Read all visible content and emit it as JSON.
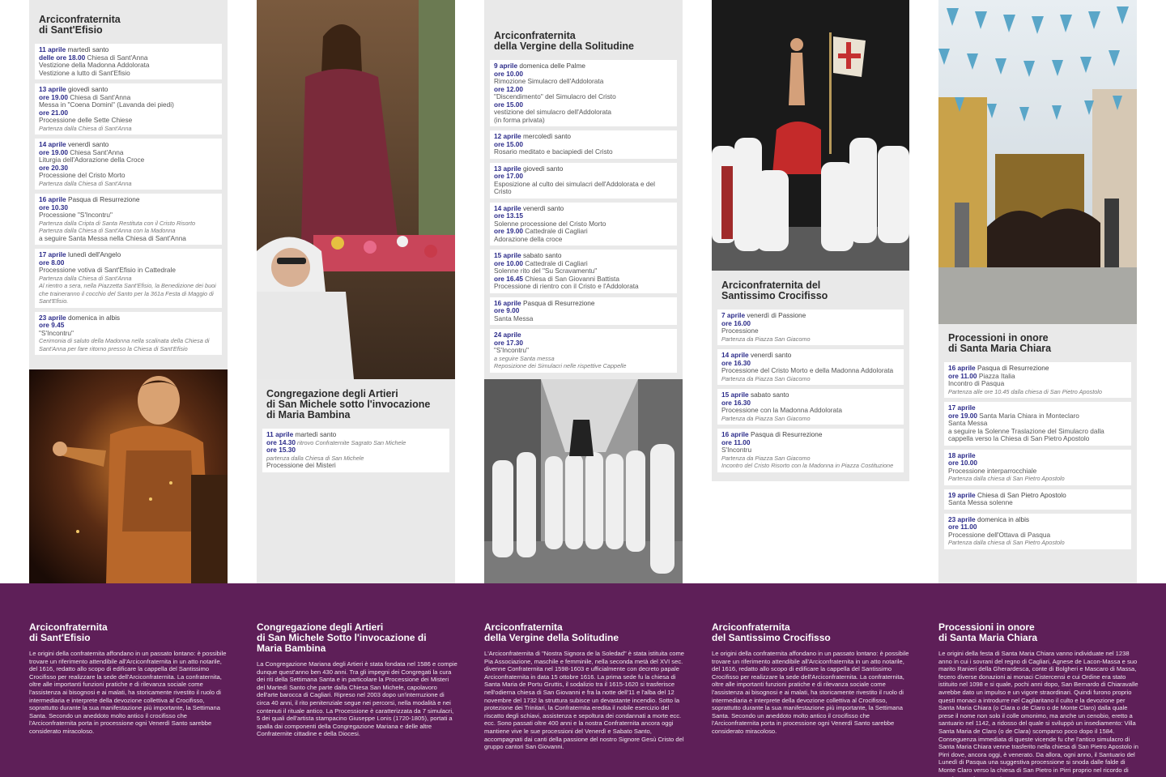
{
  "columns": [
    {
      "title": "Arciconfraternita\ndi Sant'Efisio",
      "events": [
        {
          "date": "11 aprile",
          "day": " martedì santo",
          "lines": [
            {
              "t": "delle ore 18.00",
              "x": " Chiesa di Sant'Anna"
            },
            {
              "x": "Vestizione della Madonna Addolorata"
            },
            {
              "x": "Vestizione a lutto di Sant'Efisio"
            }
          ]
        },
        {
          "date": "13 aprile",
          "day": " giovedì santo",
          "lines": [
            {
              "t": "ore 19.00",
              "x": " Chiesa di Sant'Anna"
            },
            {
              "x": "Messa in \"Coena Domini\" (Lavanda dei piedi)"
            },
            {
              "t": "ore 21.00"
            },
            {
              "x": "Processione delle Sette Chiese"
            },
            {
              "s": "Partenza dalla Chiesa di Sant'Anna"
            }
          ]
        },
        {
          "date": "14 aprile",
          "day": " venerdì santo",
          "lines": [
            {
              "t": "ore 19.00",
              "x": "        Chiesa Sant'Anna"
            },
            {
              "x": "Liturgia dell'Adorazione della Croce"
            },
            {
              "t": "ore 20.30"
            },
            {
              "x": "Processione del Cristo Morto"
            },
            {
              "s": "Partenza dalla Chiesa di Sant'Anna"
            }
          ]
        },
        {
          "date": "16 aprile",
          "day": " Pasqua di Resurrezione",
          "lines": [
            {
              "t": "ore 10.30"
            },
            {
              "x": "Processione \"S'Incontru\""
            },
            {
              "s": "Partenza dalla Cripta di Santa Restituta con il Cristo Risorto"
            },
            {
              "s": "Partenza dalla Chiesa di Sant'Anna con la Madonna"
            },
            {
              "x": "a seguire Santa Messa nella Chiesa di Sant'Anna"
            }
          ]
        },
        {
          "date": "17 aprile",
          "day": " lunedì dell'Angelo",
          "lines": [
            {
              "t": "ore 8.00"
            },
            {
              "x": "Processione votiva di Sant'Efisio in Cattedrale"
            },
            {
              "s": "Partenza dalla Chiesa di Sant'Anna"
            },
            {
              "s": "Al rientro a sera, nella Piazzetta Sant'Efisio, la Benedizione dei buoi che traineranno il cocchio del Santo per la 361a Festa di Maggio di Sant'Efisio."
            }
          ]
        },
        {
          "date": "23 aprile",
          "day": " domenica in albis",
          "lines": [
            {
              "t": "ore 9.45"
            },
            {
              "x": "\"S'Incontru\""
            },
            {
              "s": "Cerimonia di saluto della Madonna nella scalinata della Chiesa di Sant'Anna per fare ritorno presso la Chiesa di Sant'Efisio"
            }
          ]
        }
      ]
    },
    {
      "title": "Congregazione degli Artieri\ndi San Michele sotto l'invocazione\ndi Maria Bambina",
      "events": [
        {
          "date": "11 aprile",
          "day": " martedì santo",
          "lines": [
            {
              "t": "ore 14.30",
              "s": " ritrovo Confraternite Sagrato San Michele"
            },
            {
              "t": "ore 15.30"
            },
            {
              "s": "partenza dalla Chiesa di San Michele"
            },
            {
              "x": "Processione dei Misteri"
            }
          ]
        }
      ]
    },
    {
      "title": "Arciconfraternita\ndella Vergine della Solitudine",
      "events": [
        {
          "date": "9 aprile",
          "day": " domenica delle Palme",
          "lines": [
            {
              "t": "ore 10.00"
            },
            {
              "x": "Rimozione Simulacro dell'Addolorata"
            },
            {
              "t": "ore 12.00"
            },
            {
              "x": "\"Discendimento\" del Simulacro del Cristo"
            },
            {
              "t": "ore 15.00"
            },
            {
              "x": "vestizione del simulacro dell'Addolorata"
            },
            {
              "x": "(in forma privata)"
            }
          ]
        },
        {
          "date": "12 aprile",
          "day": " mercoledì santo",
          "lines": [
            {
              "t": "ore 15.00"
            },
            {
              "x": "Rosario meditato e baciapiedi del Cristo"
            }
          ]
        },
        {
          "date": "13 aprile",
          "day": " giovedì santo",
          "lines": [
            {
              "t": "ore 17.00"
            },
            {
              "x": "Esposizione al culto dei simulacri dell'Addolorata e del Cristo"
            }
          ]
        },
        {
          "date": "14 aprile",
          "day": " venerdì santo",
          "lines": [
            {
              "t": "ore 13.15"
            },
            {
              "x": "Solenne processione del Cristo Morto"
            },
            {
              "t": "ore 19.00",
              "x": " Cattedrale di Cagliari"
            },
            {
              "x": "Adorazione della croce"
            }
          ]
        },
        {
          "date": "15 aprile",
          "day": " sabato santo",
          "lines": [
            {
              "t": "ore 10.00",
              "x": "  Cattedrale di Cagliari"
            },
            {
              "x": "Solenne rito del \"Su Scravamentu\""
            },
            {
              "t": "ore 16.45",
              "x": " Chiesa di San Giovanni Battista"
            },
            {
              "x": "Processione di rientro con il Cristo e l'Addolorata"
            }
          ]
        },
        {
          "date": "16 aprile",
          "day": " Pasqua di Resurrezione",
          "lines": [
            {
              "t": "ore 9.00"
            },
            {
              "x": "Santa Messa"
            }
          ]
        },
        {
          "date": "24 aprile",
          "day": "",
          "lines": [
            {
              "t": "ore 17.30"
            },
            {
              "x": "\"S'Incontru\""
            },
            {
              "s": "a seguire Santa messa"
            },
            {
              "s": "Reposizione dei Simulacri nelle rispettive Cappelle"
            }
          ]
        }
      ]
    },
    {
      "title": "Arciconfraternita del\nSantissimo Crocifisso",
      "events": [
        {
          "date": "7 aprile",
          "day": " venerdì di Passione",
          "lines": [
            {
              "t": "ore 16.00"
            },
            {
              "x": "Processione"
            },
            {
              "s": "Partenza da Piazza San Giacomo"
            }
          ]
        },
        {
          "date": "14 aprile",
          "day": " venerdì santo",
          "lines": [
            {
              "t": "ore 16.30"
            },
            {
              "x": "Processione del Cristo Morto e della Madonna Addolorata"
            },
            {
              "s": "Partenza da Piazza San Giacomo"
            }
          ]
        },
        {
          "date": "15 aprile",
          "day": " sabato santo",
          "lines": [
            {
              "t": "ore 16.30"
            },
            {
              "x": "Processione con la Madonna Addolorata"
            },
            {
              "s": "Partenza da Piazza San Giacomo"
            }
          ]
        },
        {
          "date": "16 aprile",
          "day": " Pasqua di Resurrezione",
          "lines": [
            {
              "t": "ore 11.00"
            },
            {
              "x": "S'Incontru"
            },
            {
              "s": "Partenza da Piazza San Giacomo"
            },
            {
              "s": "Incontro del Cristo Risorto con la Madonna in Piazza Costituzione"
            }
          ]
        }
      ]
    },
    {
      "title": "Processioni in onore\ndi Santa Maria Chiara",
      "events": [
        {
          "date": "16 aprile",
          "day": "        Pasqua di Resurrezione",
          "lines": [
            {
              "t": "ore 11.00",
              "x": "        Piazza Italia"
            },
            {
              "x": "Incontro di Pasqua"
            },
            {
              "s": "Partenza alle ore 10.45 dalla chiesa di San Pietro Apostolo"
            }
          ]
        },
        {
          "date": "17 aprile",
          "day": "",
          "lines": [
            {
              "t": "ore 19.00",
              "x": " Santa Maria Chiara in Monteclaro"
            },
            {
              "x": "Santa Messa"
            },
            {
              "x": "a seguire la Solenne Traslazione del Simulacro dalla cappella verso la Chiesa di San Pietro Apostolo"
            }
          ]
        },
        {
          "date": "18 aprile",
          "day": "",
          "lines": [
            {
              "t": "ore 10.00"
            },
            {
              "x": "Processione interparrocchiale"
            },
            {
              "s": "Partenza dalla chiesa di San Pietro Apostolo"
            }
          ]
        },
        {
          "date": "19 aprile",
          "day": " Chiesa di San Pietro Apostolo",
          "lines": [
            {
              "x": "Santa Messa solenne"
            }
          ]
        },
        {
          "date": "23 aprile",
          "day": " domenica in albis",
          "lines": [
            {
              "t": "ore 11.00"
            },
            {
              "x": "Processione dell'Ottava di Pasqua"
            },
            {
              "s": "Partenza dalla chiesa di San Pietro Apostolo"
            }
          ]
        }
      ]
    }
  ],
  "bottom": [
    {
      "title": "Arciconfraternita\ndi Sant'Efisio",
      "text": "Le origini della confraternita affondano in un passato lontano: è possibile trovare un riferimento attendibile all'Arciconfraternita in un atto notarile, del 1616, redatto allo scopo di edificare la cappella del Santissimo Crocifisso per realizzare la sede dell'Arciconfraternita. La confraternita, oltre alle importanti funzioni pratiche e di rilevanza sociale come l'assistenza ai bisognosi e ai malati, ha storicamente rivestito il ruolo di intermediaria e interprete della devozione collettiva al Crocifisso, soprattutto durante la sua manifestazione più importante, la Settimana Santa. Secondo un aneddoto molto antico il crocifisso che l'Arciconfraternita porta in processione ogni Venerdì Santo sarebbe considerato miracoloso."
    },
    {
      "title": "Congregazione degli Artieri\ndi San Michele Sotto l'invocazione di\nMaria Bambina",
      "text": "La Congregazione Mariana degli Artieri è stata fondata nel 1586 e compie dunque quest'anno ben 430 anni. Tra gli impegni dei Congregati la cura dei riti della Settimana Santa e in particolare la Processione dei Misteri del Martedì Santo che parte dalla Chiesa San Michele, capolavoro dell'arte barocca di Cagliari. Ripreso nel 2003 dopo un'interruzione di circa 40 anni, il rito penitenziale segue nei percorsi, nella modalità e nei contenuti il rituale antico. La Processione è caratterizzata da 7 simulacri, 5 dei quali dell'artista stampacino Giuseppe Lonis (1720-1805), portati a spalla dai componenti della Congregazione Mariana e delle altre Confraternite cittadine e della Diocesi."
    },
    {
      "title": "Arciconfraternita\ndella Vergine della Solitudine",
      "text": "L'Arciconfraternita di \"Nostra Signora de la Soledad\" è stata istituita come Pia Associazione, maschile e femminile, nella seconda metà del XVI sec. divenne Confraternita nel 1598-1603 e ufficialmente con decreto papale Arciconfraternita in data 15 ottobre 1616. La prima sede fu la chiesa di Santa Maria de Portu Gruttis, il sodalizio tra il 1615-1620 si trasferisce nell'odierna chiesa di San Giovanni e fra la notte dell'11 e l'alba del 12 novembre del 1732 la struttura subisce un devastante incendio. Sotto la protezione dei Trinitari, la Confraternita eredita il nobile esercizio del riscatto degli schiavi, assistenza e sepoltura dei condannati a morte ecc. ecc. Sono passati oltre 400 anni e la nostra Confraternita ancora oggi mantiene vive le sue processioni del Venerdì e Sabato Santo, accompagnati dai canti della passione del nostro Signore Gesù Cristo del gruppo cantori San Giovanni."
    },
    {
      "title": "Arciconfraternita\ndel Santissimo Crocifisso",
      "text": "Le origini della confraternita affondano in un passato lontano: è possibile trovare un riferimento attendibile all'Arciconfraternita in un atto notarile, del 1616, redatto allo scopo di edificare la cappella del Santissimo Crocifisso per realizzare la sede dell'Arciconfraternita. La confraternita, oltre alle importanti funzioni pratiche e di rilevanza sociale come l'assistenza ai bisognosi e ai malati, ha storicamente rivestito il ruolo di intermediaria e interprete della devozione collettiva al Crocifisso, soprattutto durante la sua manifestazione più importante, la Settimana Santa. Secondo un aneddoto molto antico il crocifisso che l'Arciconfraternita porta in processione ogni Venerdì Santo sarebbe considerato miracoloso."
    },
    {
      "title": "Processioni in onore\ndi Santa Maria Chiara",
      "text": "Le origini della festa di Santa Maria Chiara vanno individuate nel 1238 anno in cui i sovrani del regno di Cagliari, Agnese de Lacon-Massa e suo marito Ranieri della Gherardesca, conte di Bolgheri e Mascaro di Massa, fecero diverse donazioni ai monaci Cistercensi e cui Ordine era stato istituito nel 1098 e si quale, pochi anni dopo, San Bernardo di Chiaravalle avrebbe dato un impulso e un vigore straordinari. Quindi furono proprio questi monaci a introdurre nel Cagliaritano il culto e la devozione per Santa Maria Chiara (o Clara o de Claro o de Monte Claro) dalla quale prese il nome non solo il colle omonimo, ma anche un cenobio, eretto a santuario nel 1142, a ridosso del quale si sviluppò un insediamento: Villa Santa Maria de Claro (o de Clara) scomparso poco dopo il 1584. Conseguenza immediata di queste vicende fu che l'antico simulacro di Santa Maria Chiara venne trasferito nella chiesa di San Pietro Apostolo in Pirri dove, ancora oggi, è venerato. Da allora, ogni anno, il Santuario del Lunedì di Pasqua una suggestiva processione si snoda dalle falde di Monte Claro verso la chiesa di San Pietro in Pirri proprio nel ricordo di quanto narrato avvenuto."
    }
  ],
  "colors": {
    "accent": "#2c2c8a",
    "band": "#5e1f58",
    "panel": "#e9e9e9"
  },
  "images": [
    "saint-efisio-statue-photo",
    "christ-statue-procession-photo",
    "hooded-brotherhood-procession-photo",
    "crucifix-procession-photo",
    "ox-cart-festival-photo"
  ]
}
